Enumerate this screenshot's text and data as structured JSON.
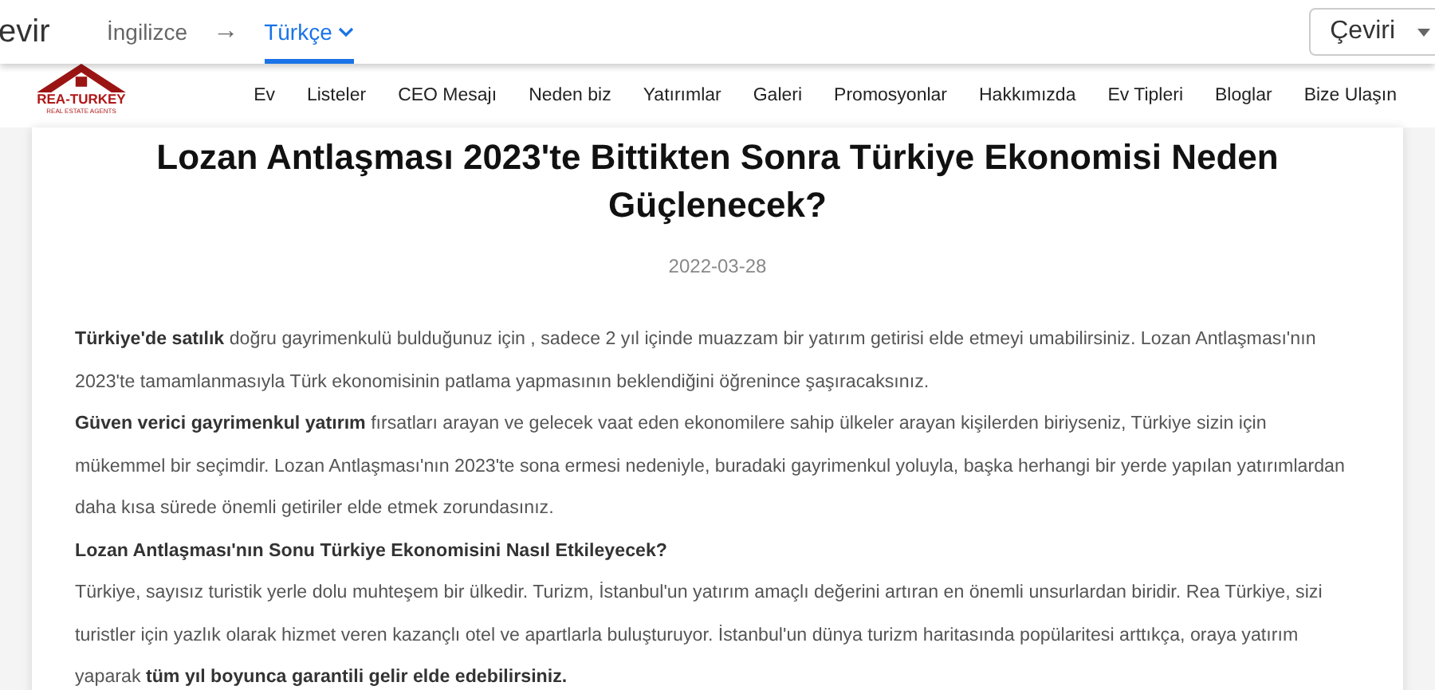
{
  "translate_bar": {
    "title": "evir",
    "languages": [
      {
        "label": "İngilizce",
        "selected": false
      },
      {
        "label": "Türkçe",
        "selected": true
      }
    ],
    "arrow": "→",
    "button": "Çeviri"
  },
  "logo": {
    "name": "REA-TURKEY",
    "tagline": "REAL ESTATE AGENTS"
  },
  "nav": [
    "Ev",
    "Listeler",
    "CEO Mesajı",
    "Neden biz",
    "Yatırımlar",
    "Galeri",
    "Promosyonlar",
    "Hakkımızda",
    "Ev Tipleri",
    "Bloglar",
    "Bize Ulaşın"
  ],
  "article": {
    "title": "Lozan Antlaşması 2023'te Bittikten Sonra Türkiye Ekonomisi Neden Güçlenecek?",
    "date": "2022-03-28",
    "blocks": [
      {
        "kind": "paragraph",
        "text": "**Türkiye'de satılık** doğru gayrimenkulü bulduğunuz için , sadece 2 yıl içinde muazzam bir yatırım getirisi elde etmeyi umabilirsiniz. Lozan Antlaşması'nın 2023'te tamamlanmasıyla Türk ekonomisinin patlama yapmasının beklendiğini öğrenince şaşıracaksınız."
      },
      {
        "kind": "paragraph",
        "text": "**Güven verici gayrimenkul yatırım** fırsatları arayan ve gelecek vaat eden ekonomilere sahip ülkeler arayan kişilerden biriyseniz, Türkiye sizin için mükemmel bir seçimdir. Lozan Antlaşması'nın 2023'te sona ermesi nedeniyle, buradaki gayrimenkul yoluyla, başka herhangi bir yerde yapılan yatırımlardan daha kısa sürede önemli getiriler elde etmek zorundasınız."
      },
      {
        "kind": "heading",
        "text": "Lozan Antlaşması'nın Sonu Türkiye Ekonomisini Nasıl Etkileyecek?"
      },
      {
        "kind": "paragraph",
        "text": "Türkiye, sayısız turistik yerle dolu muhteşem bir ülkedir. Turizm, İstanbul'un yatırım amaçlı değerini artıran en önemli unsurlardan biridir. Rea Türkiye, sizi turistler için yazlık olarak hizmet veren kazançlı otel ve apartlarla buluşturuyor. İstanbul'un dünya turizm haritasında popülaritesi arttıkça, oraya yatırım yaparak **tüm yıl boyunca garantili gelir elde edebilirsiniz.**"
      }
    ]
  }
}
